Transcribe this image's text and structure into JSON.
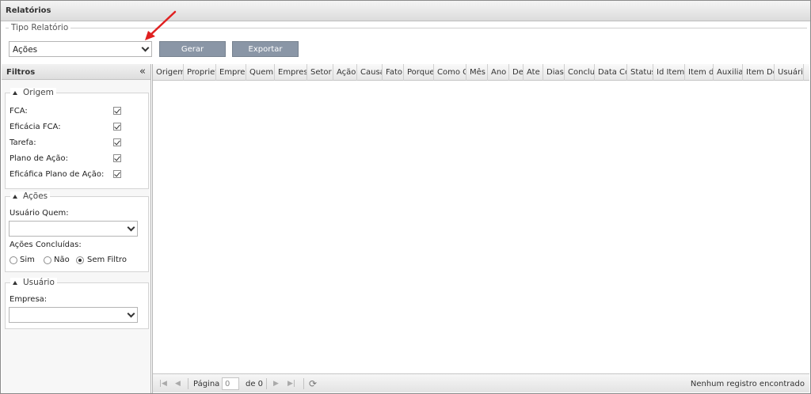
{
  "window": {
    "title": "Relatórios"
  },
  "report_type": {
    "legend": "Tipo Relatório",
    "selected": "Ações",
    "generate_label": "Gerar",
    "export_label": "Exportar"
  },
  "filters": {
    "title": "Filtros",
    "collapse_glyph": "«",
    "origem": {
      "legend": "Origem",
      "items": [
        {
          "label": "FCA:",
          "checked": true
        },
        {
          "label": "Eficácia FCA:",
          "checked": true
        },
        {
          "label": "Tarefa:",
          "checked": true
        },
        {
          "label": "Plano de Ação:",
          "checked": true
        },
        {
          "label": "Eficáfica Plano de Ação:",
          "checked": true
        }
      ]
    },
    "acoes": {
      "legend": "Ações",
      "usuario_quem_label": "Usuário Quem:",
      "usuario_quem_value": "",
      "concluidas_label": "Ações Concluídas:",
      "options": [
        {
          "label": "Sim",
          "selected": false
        },
        {
          "label": "Não",
          "selected": false
        },
        {
          "label": "Sem Filtro",
          "selected": true
        }
      ]
    },
    "usuario": {
      "legend": "Usuário",
      "empresa_label": "Empresa:",
      "empresa_value": ""
    }
  },
  "grid": {
    "columns": [
      "Origem",
      "Propriet",
      "Empresa",
      "Quem",
      "Empresa",
      "Setor",
      "Ação",
      "Causa",
      "Fato",
      "Porque",
      "Como O",
      "Mês",
      "Ano",
      "De",
      "Ate",
      "Dias",
      "Concluíc",
      "Data Co",
      "Status",
      "Id Item c",
      "Item de",
      "Auxiliar",
      "Item De",
      "Usuário"
    ],
    "rows": []
  },
  "pager": {
    "page_label": "Página",
    "page_value": "0",
    "of_label": "de 0",
    "status": "Nenhum registro encontrado"
  },
  "colors": {
    "button_bg": "#8a96a6",
    "arrow": "#e02020"
  }
}
